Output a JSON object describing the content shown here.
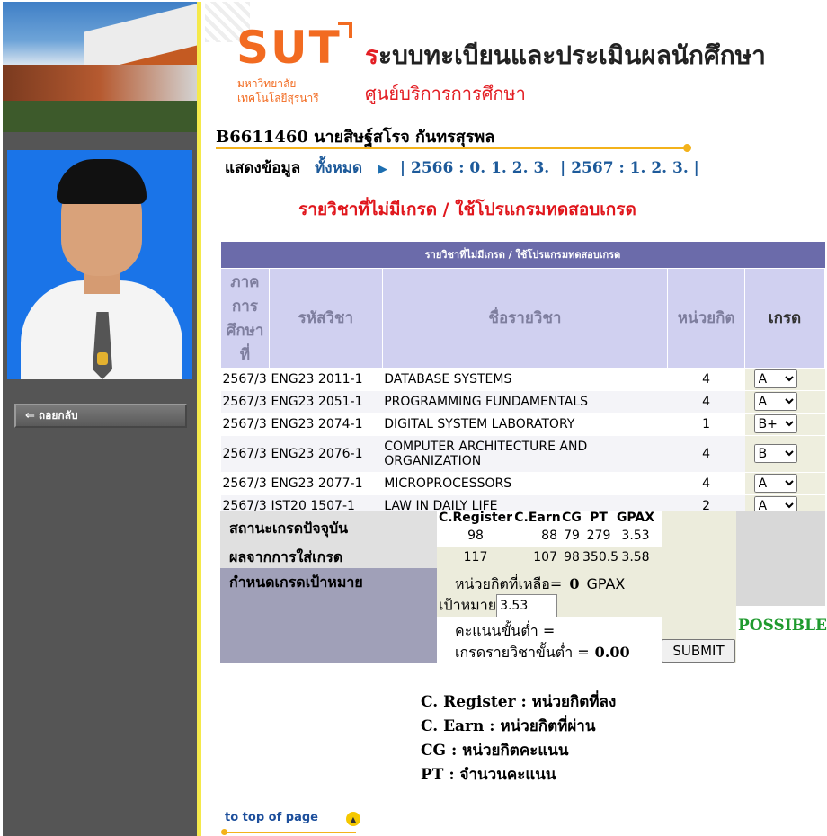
{
  "sidebar": {
    "back_label": "ถอยกลับ"
  },
  "header": {
    "logo": "SUT",
    "univ_name_line1": "มหาวิทยาลัย",
    "univ_name_line2": "เทคโนโลยีสุรนารี",
    "title_first": "ร",
    "title_rest": "ะบบทะเบียนและประเมินผลนักศึกษา",
    "subtitle": "ศูนย์บริการการศึกษา"
  },
  "student": {
    "id_name": "B6611460 นายสิษฐ์สโรจ กันทรสุรพล"
  },
  "view": {
    "label": "แสดงข้อมูล",
    "all": "ทั้งหมด",
    "sep_open": "|",
    "y2566": "2566 :",
    "y2566_terms": [
      "0.",
      "1.",
      "2.",
      "3."
    ],
    "y2567": "2567 :",
    "y2567_terms": [
      "1.",
      "2.",
      "3."
    ],
    "sep_close": "|"
  },
  "heading": "รายวิชาที่ไม่มีเกรด / ใช้โปรแกรมทดสอบเกรด",
  "table": {
    "caption": "รายวิชาที่ไม่มีเกรด / ใช้โปรแกรมทดสอบเกรด",
    "headers": [
      "ภาคการศึกษาที่",
      "รหัสวิชา",
      "ชื่อรายวิชา",
      "หน่วยกิต",
      "เกรด"
    ],
    "rows": [
      {
        "term": "2567/3",
        "code": "ENG23 2011-1",
        "name": "DATABASE SYSTEMS",
        "credit": "4",
        "grade": "A"
      },
      {
        "term": "2567/3",
        "code": "ENG23 2051-1",
        "name": "PROGRAMMING FUNDAMENTALS",
        "credit": "4",
        "grade": "A"
      },
      {
        "term": "2567/3",
        "code": "ENG23 2074-1",
        "name": "DIGITAL SYSTEM LABORATORY",
        "credit": "1",
        "grade": "B+"
      },
      {
        "term": "2567/3",
        "code": "ENG23 2076-1",
        "name": "COMPUTER ARCHITECTURE AND ORGANIZATION",
        "credit": "4",
        "grade": "B"
      },
      {
        "term": "2567/3",
        "code": "ENG23 2077-1",
        "name": "MICROPROCESSORS",
        "credit": "4",
        "grade": "A"
      },
      {
        "term": "2567/3",
        "code": "IST20 1507-1",
        "name": "LAW IN DAILY LIFE",
        "credit": "2",
        "grade": "A"
      }
    ]
  },
  "summary": {
    "current_label": "สถานะเกรดปัจจุบัน",
    "result_label": "ผลจากการใส่เกรด",
    "target_label": "กำหนดเกรดเป้าหมาย",
    "stat_headers": [
      "C.Register",
      "C.Earn",
      "CG",
      "PT",
      "GPAX"
    ],
    "current": [
      "98",
      "88",
      "79",
      "279",
      "3.53"
    ],
    "result": [
      "117",
      "107",
      "98",
      "350.5",
      "3.58"
    ],
    "remaining_label": "หน่วยกิตที่เหลือ=",
    "remaining_value": "0",
    "gpax_label": "GPAX",
    "target_word": "เป้าหมาย",
    "target_value": "3.53",
    "min_score_label": "คะแนนขั้นต่ำ =",
    "min_grade_label": "เกรดรายวิชาขั้นต่ำ =",
    "min_grade_value": "0.00",
    "submit_label": "SUBMIT",
    "status": "POSSIBLE"
  },
  "legend": [
    "C. Register : หน่วยกิตที่ลง",
    "C. Earn : หน่วยกิตที่ผ่าน",
    "CG : หน่วยกิตคะแนน",
    "PT : จำนวนคะแนน"
  ],
  "footer": {
    "top_link": "to top of page"
  },
  "colors": {
    "brand_orange": "#f26b21",
    "title_red": "#e31e24",
    "link_blue": "#1d5a9a",
    "table_header": "#6b6baa",
    "status_green": "#1f9a2e"
  },
  "icons": [
    "back-arrow-icon",
    "play-triangle-icon",
    "up-arrow-icon"
  ]
}
